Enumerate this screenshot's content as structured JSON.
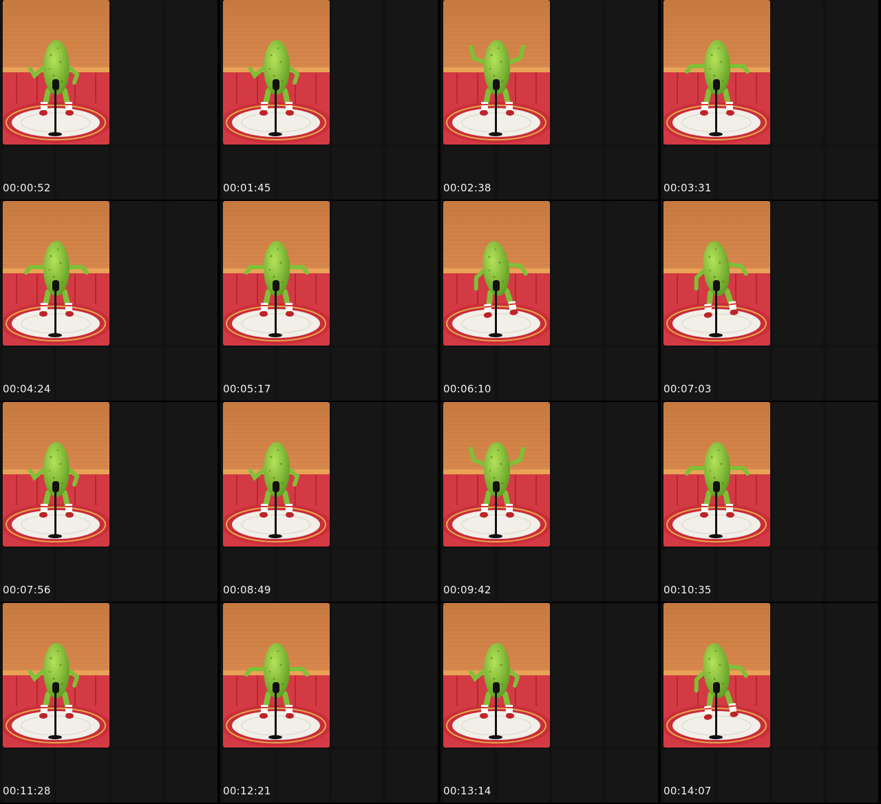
{
  "frames": [
    {
      "timestamp": "00:00:52",
      "pose": "arms-down"
    },
    {
      "timestamp": "00:01:45",
      "pose": "arms-down"
    },
    {
      "timestamp": "00:02:38",
      "pose": "arms-up"
    },
    {
      "timestamp": "00:03:31",
      "pose": "arms-out"
    },
    {
      "timestamp": "00:04:24",
      "pose": "arms-out"
    },
    {
      "timestamp": "00:05:17",
      "pose": "arms-out"
    },
    {
      "timestamp": "00:06:10",
      "pose": "leaning"
    },
    {
      "timestamp": "00:07:03",
      "pose": "leaning"
    },
    {
      "timestamp": "00:07:56",
      "pose": "arms-down"
    },
    {
      "timestamp": "00:08:49",
      "pose": "arms-down"
    },
    {
      "timestamp": "00:09:42",
      "pose": "arms-up"
    },
    {
      "timestamp": "00:10:35",
      "pose": "arms-out"
    },
    {
      "timestamp": "00:11:28",
      "pose": "arms-down"
    },
    {
      "timestamp": "00:12:21",
      "pose": "arms-out"
    },
    {
      "timestamp": "00:13:14",
      "pose": "arms-down"
    },
    {
      "timestamp": "00:14:07",
      "pose": "leaning"
    }
  ],
  "colors": {
    "background": "#000000",
    "wall": "#d9894e",
    "stage_red": "#d43a44",
    "pickle": "#8bc63a",
    "timestamp_text": "#f2f2f2"
  }
}
